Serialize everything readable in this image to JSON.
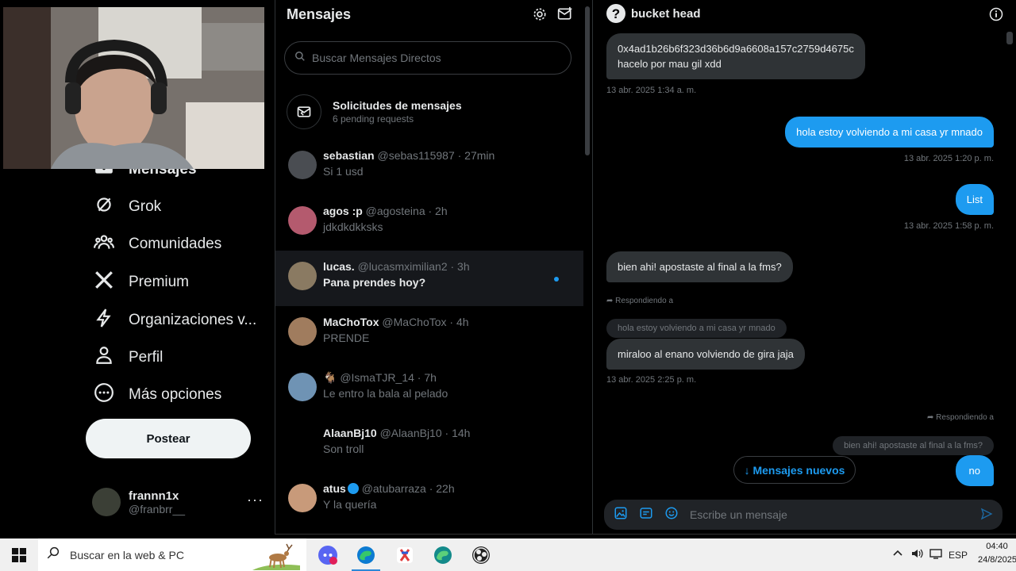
{
  "nav": {
    "items": [
      {
        "label": "Mensajes",
        "icon": "envelope-icon"
      },
      {
        "label": "Grok",
        "icon": "grok-icon"
      },
      {
        "label": "Comunidades",
        "icon": "communities-icon"
      },
      {
        "label": "Premium",
        "icon": "x-logo-icon"
      },
      {
        "label": "Organizaciones v...",
        "icon": "lightning-icon"
      },
      {
        "label": "Perfil",
        "icon": "person-icon"
      },
      {
        "label": "Más opciones",
        "icon": "more-circle-icon"
      }
    ],
    "post_label": "Postear",
    "account": {
      "name": "frannn1x",
      "handle": "@franbrr__",
      "more": "···"
    }
  },
  "messages": {
    "title": "Mensajes",
    "search_placeholder": "Buscar Mensajes Directos",
    "requests": {
      "title": "Solicitudes de mensajes",
      "subtitle": "6 pending requests"
    },
    "conversations": [
      {
        "name": "sebastian",
        "handle": "@sebas115987 · 27min",
        "preview": "Si 1 usd",
        "active": false,
        "color": "#4a4d52"
      },
      {
        "name": "agos :p",
        "handle": "@agosteina · 2h",
        "preview": "jdkdkdkksks",
        "active": false,
        "color": "#b45a6e"
      },
      {
        "name": "lucas.",
        "handle": "@lucasmximilian2 · 3h",
        "preview": "Pana prendes hoy?",
        "active": true,
        "color": "#8a7a62"
      },
      {
        "name": "MaChoTox",
        "handle": "@MaChoTox · 4h",
        "preview": "PRENDE",
        "active": false,
        "color": "#a07c5e"
      },
      {
        "name": "🐐",
        "handle": "@IsmaTJR_14 · 7h",
        "preview": "Le entro la bala al pelado",
        "active": false,
        "color": "#6f93b4"
      },
      {
        "name": "AlaanBj10",
        "handle": "@AlaanBj10 · 14h",
        "preview": "Son troll",
        "active": false,
        "color": "#000000"
      },
      {
        "name": "atus",
        "handle": "@atubarraza · 22h",
        "preview": "Y la quería",
        "active": false,
        "color": "#c89a7a"
      }
    ]
  },
  "conversation": {
    "name": "bucket head",
    "msg1_line1": "0x4ad1b26b6f323d36b6d9a6608a157c2759d4675c",
    "msg1_line2": "hacelo por mau gil xdd",
    "ts1": "13 abr. 2025 1:34 a. m.",
    "msg2": "hola estoy volviendo a mi casa  yr mnado",
    "ts2": "13 abr. 2025 1:20 p. m.",
    "msg3": "List",
    "ts3": "13 abr. 2025 1:58 p. m.",
    "msg4": "bien ahi! apostaste al final a la fms?",
    "reply_label": "Respondiendo a",
    "quote1": "hola estoy volviendo a mi casa  yr mnado",
    "msg5": "miraloo al enano volviendo de gira jaja",
    "ts5": "13 abr. 2025 2:25 p. m.",
    "quote2": "bien ahi! apostaste al final a la fms?",
    "msg6": "no",
    "new_messages": "↓ Mensajes nuevos",
    "composer_placeholder": "Escribe un mensaje"
  },
  "taskbar": {
    "search_placeholder": "Buscar en la web & PC",
    "lang": "ESP",
    "time": "04:40",
    "date": "24/8/2025"
  }
}
